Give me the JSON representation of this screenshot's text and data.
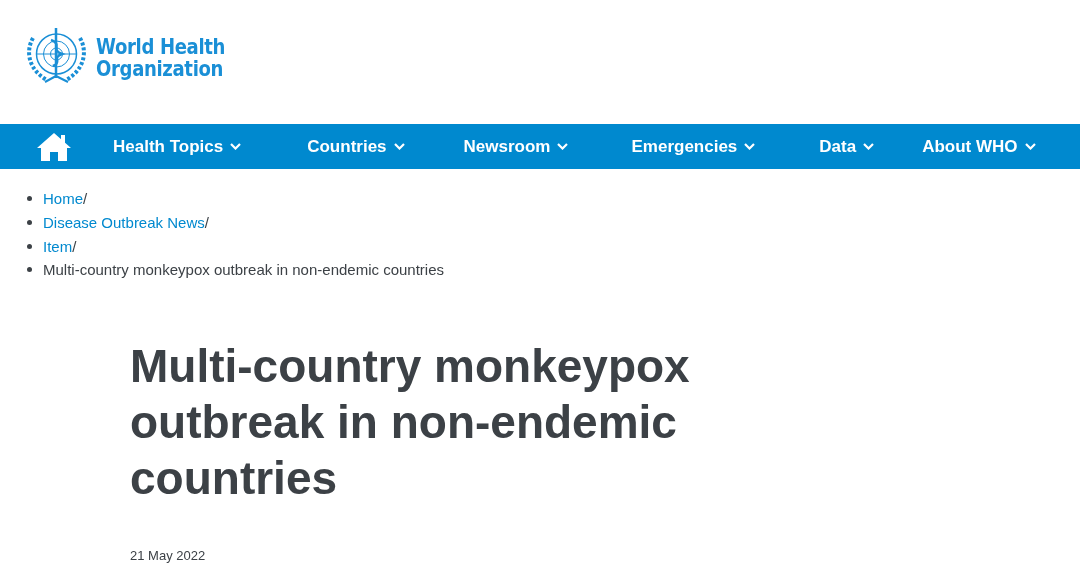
{
  "logo": {
    "line_1": "World Health",
    "line_2": "Organization"
  },
  "nav": {
    "items": [
      {
        "label": "Health Topics",
        "dropdown": true
      },
      {
        "label": "Countries",
        "dropdown": true
      },
      {
        "label": "Newsroom",
        "dropdown": true
      },
      {
        "label": "Emergencies",
        "dropdown": true
      },
      {
        "label": "Data",
        "dropdown": true
      },
      {
        "label": "About WHO",
        "dropdown": true
      }
    ]
  },
  "breadcrumb": [
    {
      "kind": "link",
      "label": "Home",
      "separator": "/"
    },
    {
      "kind": "link",
      "label": "Disease Outbreak News",
      "separator": "/"
    },
    {
      "kind": "link",
      "label": "Item",
      "separator": "/"
    },
    {
      "kind": "current",
      "label": "Multi-country monkeypox outbreak in non-endemic countries"
    }
  ],
  "article": {
    "title": "Multi-country monkeypox outbreak in non-endemic countries",
    "date": "21 May 2022"
  }
}
